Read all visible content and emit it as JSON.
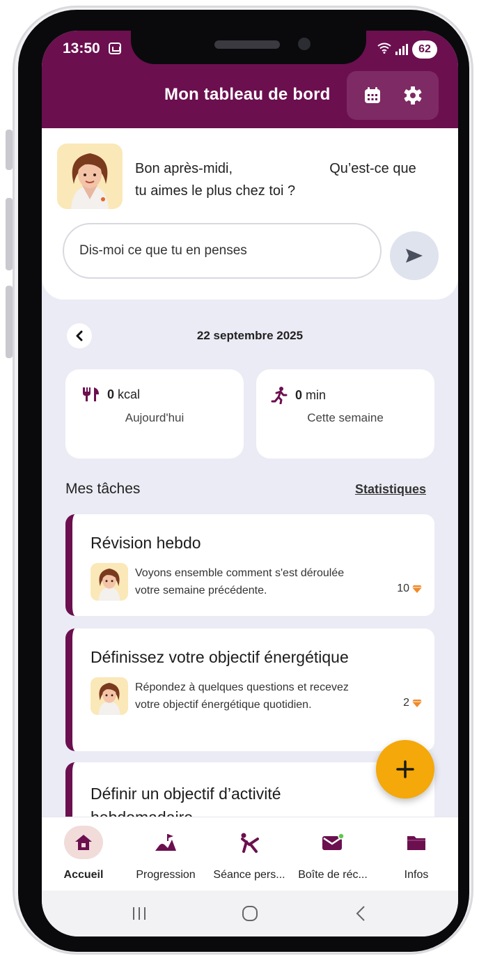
{
  "status_bar": {
    "time": "13:50",
    "battery": "62",
    "wifi_icon": "wifi-icon",
    "signal_icon": "signal-icon"
  },
  "header": {
    "title": "Mon tableau de bord",
    "icons": [
      "calendar-icon",
      "gear-icon"
    ],
    "color": "#6b0f4f"
  },
  "chat": {
    "greeting_start": "Bon après-midi,",
    "greeting_end": "Qu’est-ce que",
    "greeting_line2": "tu aimes le plus chez toi ?",
    "input_placeholder": "Dis-moi ce que tu en penses"
  },
  "date": "22 septembre 2025",
  "stats": [
    {
      "icon": "fork-knife-icon",
      "value": "0",
      "unit": "kcal",
      "label": "Aujourd'hui"
    },
    {
      "icon": "running-icon",
      "value": "0",
      "unit": "min",
      "label": "Cette semaine"
    }
  ],
  "tasks_section": {
    "title": "Mes tâches",
    "link": "Statistiques"
  },
  "tasks": [
    {
      "title": "Révision hebdo",
      "desc_line1": "Voyons ensemble comment s'est déroulée",
      "desc_line2": "votre semaine précédente.",
      "points": "10"
    },
    {
      "title": "Définissez votre objectif énergétique",
      "desc_line1": "Répondez à quelques questions et recevez",
      "desc_line2": "votre objectif énergétique quotidien.",
      "points": "2"
    },
    {
      "title": "Définir un objectif d’activité",
      "title_line2": "hebdomadaire"
    }
  ],
  "fab_label": "+",
  "bottom_nav": [
    {
      "label": "Accueil",
      "icon": "home-icon",
      "active": true
    },
    {
      "label": "Progression",
      "icon": "progress-icon",
      "active": false
    },
    {
      "label": "Séance pers...",
      "icon": "exercise-icon",
      "active": false
    },
    {
      "label": "Boîte de réc...",
      "icon": "mail-icon",
      "active": false
    },
    {
      "label": "Infos",
      "icon": "folder-icon",
      "active": false
    }
  ],
  "accent_color": "#f4a809",
  "system_nav": [
    "recents-icon",
    "home-circle-icon",
    "back-icon"
  ]
}
